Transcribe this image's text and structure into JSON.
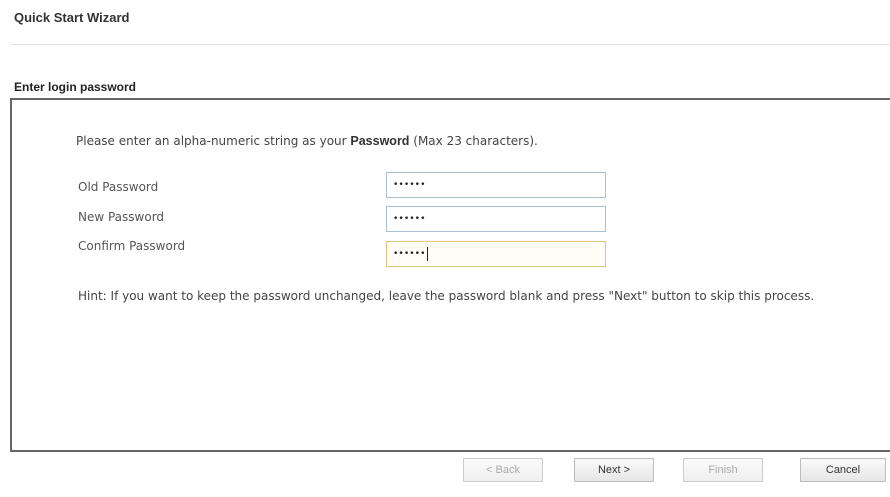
{
  "wizard": {
    "title": "Quick Start Wizard"
  },
  "section": {
    "title": "Enter login password"
  },
  "form": {
    "intro_prefix": "Please enter an alpha-numeric string as your ",
    "intro_strong": "Password",
    "intro_suffix": " (Max 23 characters).",
    "fields": [
      {
        "label": "Old Password",
        "masked_value": "••••••"
      },
      {
        "label": "New Password",
        "masked_value": "••••••"
      },
      {
        "label": "Confirm Password",
        "masked_value": "••••••"
      }
    ],
    "hint": "Hint: If you want to keep the password unchanged, leave the password blank and press \"Next\" button to skip this process."
  },
  "buttons": {
    "back": "< Back",
    "next": "Next >",
    "finish": "Finish",
    "cancel": "Cancel"
  },
  "colors": {
    "panel_border": "#666666",
    "input_border": "#a9bfd6",
    "focused_input_border": "#e2c488"
  }
}
